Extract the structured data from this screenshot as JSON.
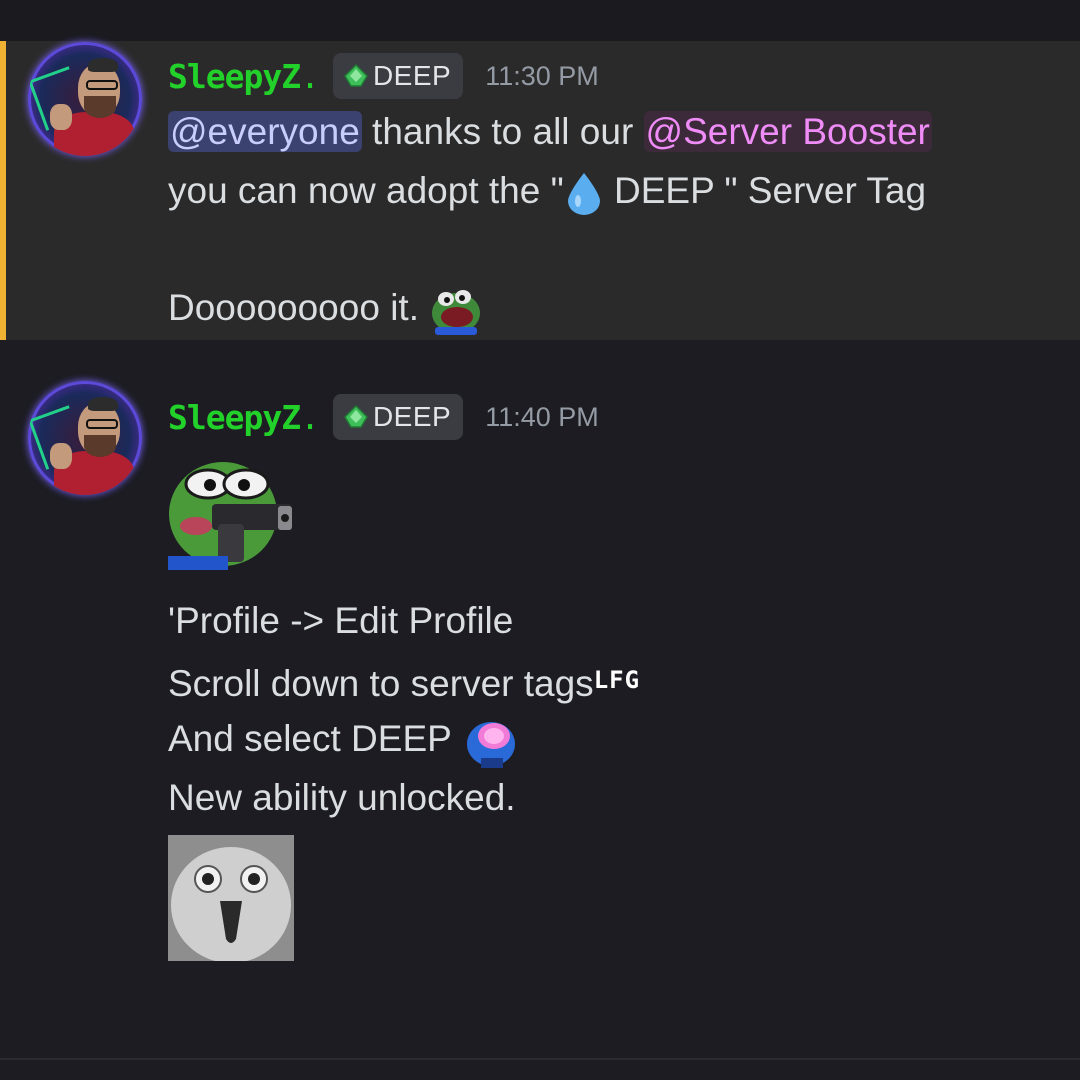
{
  "messages": [
    {
      "username": "SleepyZ",
      "username_suffix": ".",
      "server_tag": "DEEP",
      "timestamp": "11:30 PM",
      "mention_everyone": "@everyone",
      "line1_text": " thanks to all our ",
      "mention_role": "@Server Booster",
      "line2_prefix": "you can now adopt the \"",
      "line2_suffix": " DEEP \" Server Tag",
      "line3": "Dooooooooo it.",
      "highlighted": true
    },
    {
      "username": "SleepyZ",
      "username_suffix": ".",
      "server_tag": "DEEP",
      "timestamp": "11:40 PM",
      "line1": "'Profile -> Edit Profile",
      "line2": "Scroll down to server tags",
      "line2_emoji_text": "LFG",
      "line3": "And select DEEP",
      "line4": "New ability unlocked."
    }
  ],
  "colors": {
    "username": "#22d22a",
    "highlight_bar": "#f0b232",
    "everyone_mention_bg": "#3c4270",
    "role_mention_text": "#f08cf7",
    "timestamp": "#949ba4"
  },
  "icons": {
    "tag_icon": "green-gem-icon",
    "droplet": "droplet-emoji",
    "frog_emoji": "frog-laughing-emoji",
    "pepe_gun": "pepe-gun-sticker",
    "brain": "brain-emoji",
    "owl": "owl-surprised-sticker"
  }
}
